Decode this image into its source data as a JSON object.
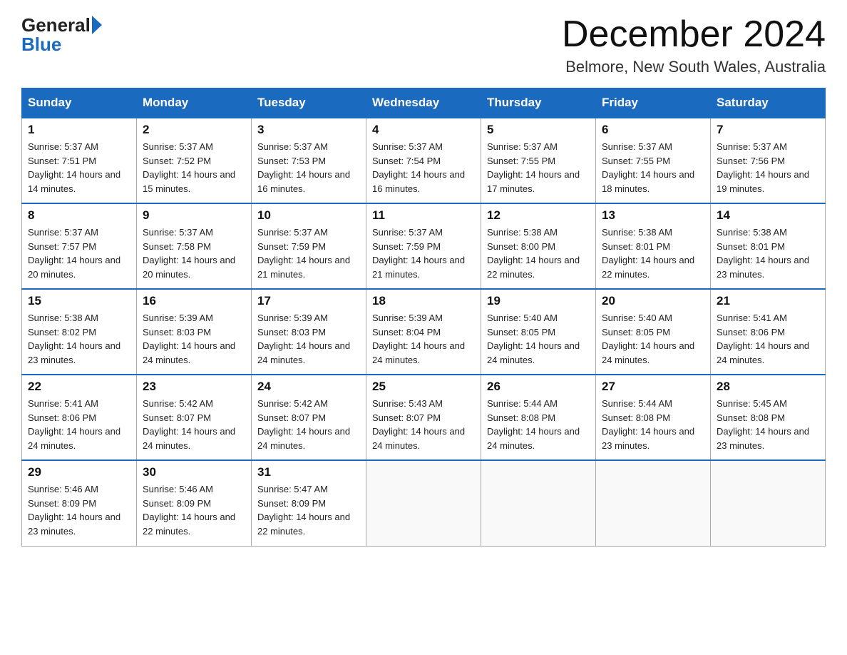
{
  "header": {
    "logo_general": "General",
    "logo_blue": "Blue",
    "month_title": "December 2024",
    "location": "Belmore, New South Wales, Australia"
  },
  "days_of_week": [
    "Sunday",
    "Monday",
    "Tuesday",
    "Wednesday",
    "Thursday",
    "Friday",
    "Saturday"
  ],
  "weeks": [
    [
      {
        "num": "1",
        "sunrise": "5:37 AM",
        "sunset": "7:51 PM",
        "daylight": "14 hours and 14 minutes."
      },
      {
        "num": "2",
        "sunrise": "5:37 AM",
        "sunset": "7:52 PM",
        "daylight": "14 hours and 15 minutes."
      },
      {
        "num": "3",
        "sunrise": "5:37 AM",
        "sunset": "7:53 PM",
        "daylight": "14 hours and 16 minutes."
      },
      {
        "num": "4",
        "sunrise": "5:37 AM",
        "sunset": "7:54 PM",
        "daylight": "14 hours and 16 minutes."
      },
      {
        "num": "5",
        "sunrise": "5:37 AM",
        "sunset": "7:55 PM",
        "daylight": "14 hours and 17 minutes."
      },
      {
        "num": "6",
        "sunrise": "5:37 AM",
        "sunset": "7:55 PM",
        "daylight": "14 hours and 18 minutes."
      },
      {
        "num": "7",
        "sunrise": "5:37 AM",
        "sunset": "7:56 PM",
        "daylight": "14 hours and 19 minutes."
      }
    ],
    [
      {
        "num": "8",
        "sunrise": "5:37 AM",
        "sunset": "7:57 PM",
        "daylight": "14 hours and 20 minutes."
      },
      {
        "num": "9",
        "sunrise": "5:37 AM",
        "sunset": "7:58 PM",
        "daylight": "14 hours and 20 minutes."
      },
      {
        "num": "10",
        "sunrise": "5:37 AM",
        "sunset": "7:59 PM",
        "daylight": "14 hours and 21 minutes."
      },
      {
        "num": "11",
        "sunrise": "5:37 AM",
        "sunset": "7:59 PM",
        "daylight": "14 hours and 21 minutes."
      },
      {
        "num": "12",
        "sunrise": "5:38 AM",
        "sunset": "8:00 PM",
        "daylight": "14 hours and 22 minutes."
      },
      {
        "num": "13",
        "sunrise": "5:38 AM",
        "sunset": "8:01 PM",
        "daylight": "14 hours and 22 minutes."
      },
      {
        "num": "14",
        "sunrise": "5:38 AM",
        "sunset": "8:01 PM",
        "daylight": "14 hours and 23 minutes."
      }
    ],
    [
      {
        "num": "15",
        "sunrise": "5:38 AM",
        "sunset": "8:02 PM",
        "daylight": "14 hours and 23 minutes."
      },
      {
        "num": "16",
        "sunrise": "5:39 AM",
        "sunset": "8:03 PM",
        "daylight": "14 hours and 24 minutes."
      },
      {
        "num": "17",
        "sunrise": "5:39 AM",
        "sunset": "8:03 PM",
        "daylight": "14 hours and 24 minutes."
      },
      {
        "num": "18",
        "sunrise": "5:39 AM",
        "sunset": "8:04 PM",
        "daylight": "14 hours and 24 minutes."
      },
      {
        "num": "19",
        "sunrise": "5:40 AM",
        "sunset": "8:05 PM",
        "daylight": "14 hours and 24 minutes."
      },
      {
        "num": "20",
        "sunrise": "5:40 AM",
        "sunset": "8:05 PM",
        "daylight": "14 hours and 24 minutes."
      },
      {
        "num": "21",
        "sunrise": "5:41 AM",
        "sunset": "8:06 PM",
        "daylight": "14 hours and 24 minutes."
      }
    ],
    [
      {
        "num": "22",
        "sunrise": "5:41 AM",
        "sunset": "8:06 PM",
        "daylight": "14 hours and 24 minutes."
      },
      {
        "num": "23",
        "sunrise": "5:42 AM",
        "sunset": "8:07 PM",
        "daylight": "14 hours and 24 minutes."
      },
      {
        "num": "24",
        "sunrise": "5:42 AM",
        "sunset": "8:07 PM",
        "daylight": "14 hours and 24 minutes."
      },
      {
        "num": "25",
        "sunrise": "5:43 AM",
        "sunset": "8:07 PM",
        "daylight": "14 hours and 24 minutes."
      },
      {
        "num": "26",
        "sunrise": "5:44 AM",
        "sunset": "8:08 PM",
        "daylight": "14 hours and 24 minutes."
      },
      {
        "num": "27",
        "sunrise": "5:44 AM",
        "sunset": "8:08 PM",
        "daylight": "14 hours and 23 minutes."
      },
      {
        "num": "28",
        "sunrise": "5:45 AM",
        "sunset": "8:08 PM",
        "daylight": "14 hours and 23 minutes."
      }
    ],
    [
      {
        "num": "29",
        "sunrise": "5:46 AM",
        "sunset": "8:09 PM",
        "daylight": "14 hours and 23 minutes."
      },
      {
        "num": "30",
        "sunrise": "5:46 AM",
        "sunset": "8:09 PM",
        "daylight": "14 hours and 22 minutes."
      },
      {
        "num": "31",
        "sunrise": "5:47 AM",
        "sunset": "8:09 PM",
        "daylight": "14 hours and 22 minutes."
      },
      null,
      null,
      null,
      null
    ]
  ]
}
